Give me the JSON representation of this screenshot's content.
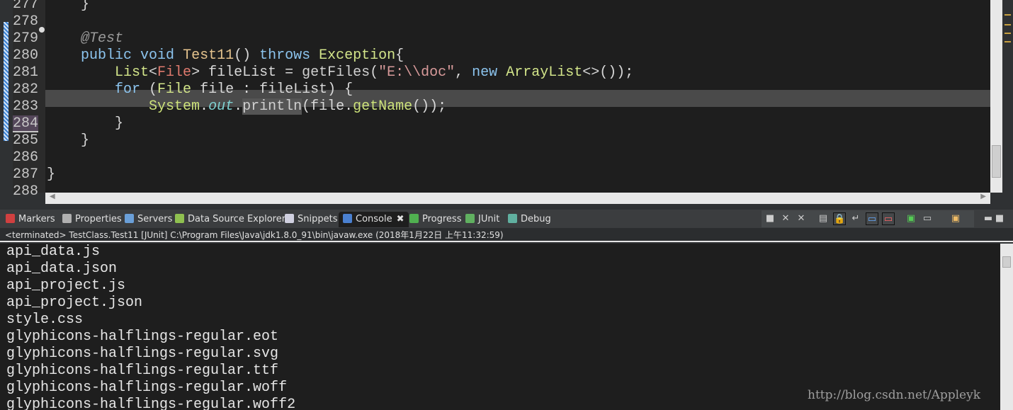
{
  "editor": {
    "line_numbers": [
      "277",
      "278",
      "279",
      "280",
      "281",
      "282",
      "283",
      "284",
      "285",
      "286",
      "287",
      "288"
    ],
    "current_line": "284",
    "lines": [
      [
        {
          "t": "    }",
          "c": ""
        }
      ],
      [],
      [
        {
          "t": "    ",
          "c": ""
        },
        {
          "t": "@Test",
          "c": "an"
        }
      ],
      [
        {
          "t": "    ",
          "c": ""
        },
        {
          "t": "public",
          "c": "kw"
        },
        {
          "t": " ",
          "c": ""
        },
        {
          "t": "void",
          "c": "kw"
        },
        {
          "t": " ",
          "c": ""
        },
        {
          "t": "Test11",
          "c": "fn"
        },
        {
          "t": "() ",
          "c": ""
        },
        {
          "t": "throws",
          "c": "kw"
        },
        {
          "t": " ",
          "c": ""
        },
        {
          "t": "Exception",
          "c": "ty"
        },
        {
          "t": "{",
          "c": ""
        }
      ],
      [
        {
          "t": "        ",
          "c": ""
        },
        {
          "t": "List",
          "c": "ty"
        },
        {
          "t": "<",
          "c": ""
        },
        {
          "t": "File",
          "c": "ge"
        },
        {
          "t": "> fileList = ",
          "c": ""
        },
        {
          "t": "getFiles",
          "c": "mt"
        },
        {
          "t": "(",
          "c": ""
        },
        {
          "t": "\"E:\\\\doc\"",
          "c": "st"
        },
        {
          "t": ", ",
          "c": ""
        },
        {
          "t": "new",
          "c": "kw"
        },
        {
          "t": " ",
          "c": ""
        },
        {
          "t": "ArrayList",
          "c": "ty"
        },
        {
          "t": "<>());",
          "c": ""
        }
      ],
      [
        {
          "t": "        ",
          "c": ""
        },
        {
          "t": "for",
          "c": "kw"
        },
        {
          "t": " (",
          "c": ""
        },
        {
          "t": "File",
          "c": "ty"
        },
        {
          "t": " file : fileList) {",
          "c": ""
        }
      ],
      [
        {
          "t": "            ",
          "c": ""
        },
        {
          "t": "System",
          "c": "sy"
        },
        {
          "t": ".",
          "c": ""
        },
        {
          "t": "out",
          "c": "it"
        },
        {
          "t": ".",
          "c": ""
        },
        {
          "t": "println",
          "c": "mt mark"
        },
        {
          "t": "(file.",
          "c": ""
        },
        {
          "t": "getName",
          "c": "sy"
        },
        {
          "t": "());",
          "c": ""
        }
      ],
      [
        {
          "t": "        }",
          "c": ""
        }
      ],
      [
        {
          "t": "    }",
          "c": ""
        }
      ],
      [],
      [
        {
          "t": "}",
          "c": ""
        }
      ],
      []
    ]
  },
  "panel": {
    "tabs": [
      {
        "label": "Markers",
        "icon": "markers-icon",
        "color": "#d04040"
      },
      {
        "label": "Properties",
        "icon": "properties-icon",
        "color": "#b0b0b0"
      },
      {
        "label": "Servers",
        "icon": "servers-icon",
        "color": "#6a9fd8"
      },
      {
        "label": "Data Source Explorer",
        "icon": "data-source-icon",
        "color": "#8fc050"
      },
      {
        "label": "Snippets",
        "icon": "snippets-icon",
        "color": "#d0d0e0"
      },
      {
        "label": "Console",
        "icon": "console-icon",
        "color": "#4a80d0",
        "active": true
      },
      {
        "label": "Progress",
        "icon": "progress-icon",
        "color": "#50b050"
      },
      {
        "label": "JUnit",
        "icon": "junit-icon",
        "color": "#60b060"
      },
      {
        "label": "Debug",
        "icon": "debug-icon",
        "color": "#60b0a0"
      }
    ],
    "close_glyph": "✖",
    "status": "<terminated> TestClass.Test11 [JUnit] C:\\Program Files\\Java\\jdk1.8.0_91\\bin\\javaw.exe (2018年1月22日 上午11:32:59)",
    "output": [
      "api_data.js",
      "api_data.json",
      "api_project.js",
      "api_project.json",
      "style.css",
      "glyphicons-halflings-regular.eot",
      "glyphicons-halflings-regular.svg",
      "glyphicons-halflings-regular.ttf",
      "glyphicons-halflings-regular.woff",
      "glyphicons-halflings-regular.woff2"
    ]
  },
  "watermark": "http://blog.csdn.net/Appleyk"
}
